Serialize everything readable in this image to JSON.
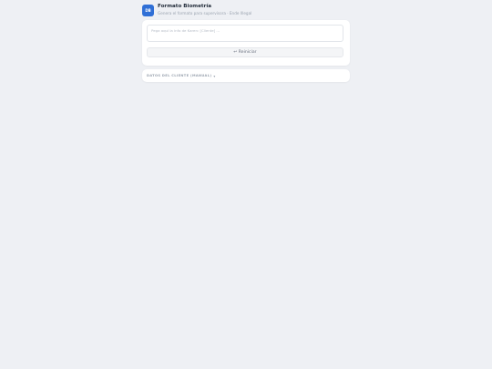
{
  "header": {
    "logo_text": "DB",
    "title": "Formato Biometría",
    "subtitle": "Genera el formato para supervisora · Ende Illegal"
  },
  "input": {
    "placeholder": "Pega aquí la info de Karen: [Cliente] ..."
  },
  "reset_button": {
    "icon": "↩",
    "label": "Reiniciar"
  },
  "client_section": {
    "label": "DATOS DEL CLIENTE (MANUAL)",
    "icon": "▾"
  },
  "colors": {
    "background": "#eef0f4",
    "accent": "#2f6fd6",
    "card": "#ffffff"
  }
}
